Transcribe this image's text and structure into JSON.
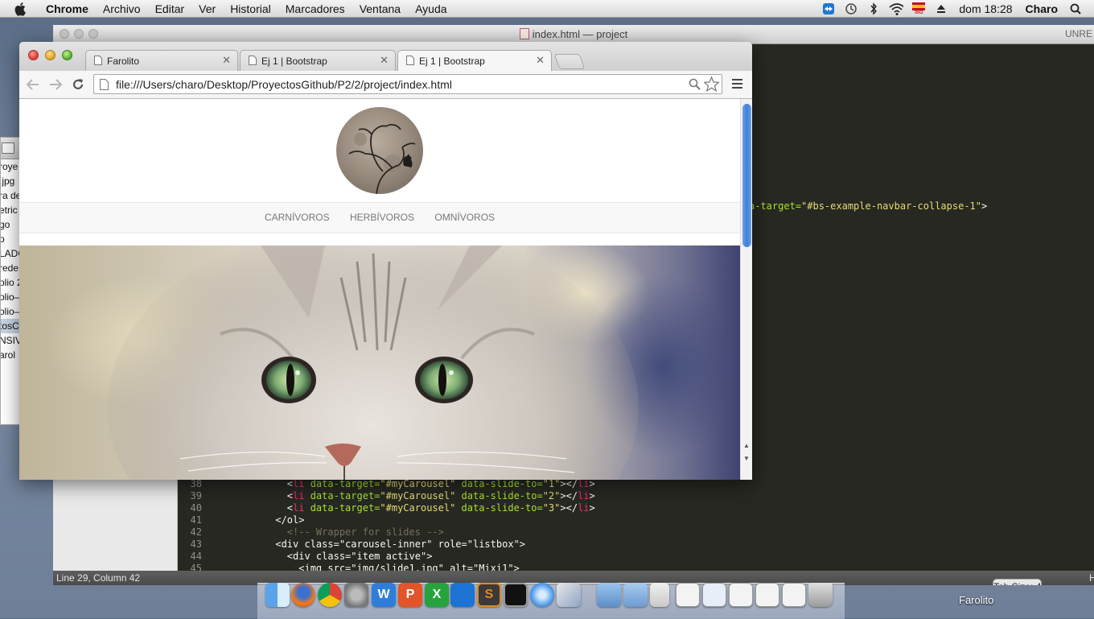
{
  "menubar": {
    "app": "Chrome",
    "items": [
      "Archivo",
      "Editar",
      "Ver",
      "Historial",
      "Marcadores",
      "Ventana",
      "Ayuda"
    ],
    "clock": "dom 18:28",
    "user": "Charo",
    "icons": [
      "teamviewer-icon",
      "time-machine-icon",
      "bluetooth-icon",
      "wifi-icon",
      "spanish-input-flag-icon",
      "eject-icon",
      "spotlight-search-icon"
    ],
    "flag_label": "ISO"
  },
  "editor": {
    "title": "index.html — project",
    "title_right": "UNRE",
    "status_position": "Line 29, Column 42",
    "status_tab": "Tab Size: 4",
    "status_extra": "H",
    "fragment_line": {
      "attr": "a-target=",
      "value": "\"#bs-example-navbar-collapse-1\"",
      "tail": ">"
    },
    "lines": [
      {
        "num": "38",
        "indent": "        ",
        "open": "<",
        "tag": "li",
        "attr": " data-target=",
        "val": "\"#myCarousel\"",
        "attr2": " data-slide-to=",
        "val2": "\"1\"",
        "close": "></",
        "tag2": "li",
        "end": ">"
      },
      {
        "num": "39",
        "indent": "        ",
        "open": "<",
        "tag": "li",
        "attr": " data-target=",
        "val": "\"#myCarousel\"",
        "attr2": " data-slide-to=",
        "val2": "\"2\"",
        "close": "></",
        "tag2": "li",
        "end": ">"
      },
      {
        "num": "40",
        "indent": "        ",
        "open": "<",
        "tag": "li",
        "attr": " data-target=",
        "val": "\"#myCarousel\"",
        "attr2": " data-slide-to=",
        "val2": "\"3\"",
        "close": "></",
        "tag2": "li",
        "end": ">"
      },
      {
        "num": "41",
        "text": "      </ol>"
      },
      {
        "num": "42",
        "comment": "        <!-- Wrapper for slides -->"
      },
      {
        "num": "43",
        "text": "      <div class=\"carousel-inner\" role=\"listbox\">"
      },
      {
        "num": "44",
        "text": "        <div class=\"item active\">"
      },
      {
        "num": "45",
        "text": "          <img src=\"img/slide1.jpg\" alt=\"Mixi1\">"
      }
    ]
  },
  "finder": {
    "items": [
      "roye",
      ".jpg",
      "ra de",
      "etric",
      "go",
      "o",
      "LADC",
      "rede",
      "olio 2",
      "olio–",
      "olio–",
      "tosC",
      "NSIV",
      "arol"
    ],
    "selected_index": 11
  },
  "chrome": {
    "tabs": [
      {
        "title": "Farolito",
        "close": "✕"
      },
      {
        "title": "Ej 1 | Bootstrap",
        "close": "✕"
      },
      {
        "title": "Ej 1 | Bootstrap",
        "close": "✕"
      }
    ],
    "active_tab": 2,
    "url": "file:///Users/charo/Desktop/ProyectosGithub/P2/2/project/index.html"
  },
  "page": {
    "nav_links": [
      "CARNÍVOROS",
      "HERBÍVOROS",
      "OMNÍVOROS"
    ]
  },
  "dock": {
    "label": "Farolito",
    "apps": [
      "finder-icon",
      "firefox-icon",
      "chrome-icon",
      "system-preferences-icon",
      "word-icon",
      "powerpoint-icon",
      "excel-icon",
      "teamviewer-icon",
      "sublime-text-icon",
      "terminal-icon",
      "itunes-icon",
      "preview-icon",
      "applications-folder-icon",
      "documents-folder-icon",
      "archive-icon",
      "chrome-window-1-icon",
      "chrome-window-2-icon",
      "chrome-window-3-icon",
      "chrome-window-4-icon",
      "chrome-window-5-icon",
      "chrome-window-6-icon",
      "trash-icon"
    ]
  }
}
